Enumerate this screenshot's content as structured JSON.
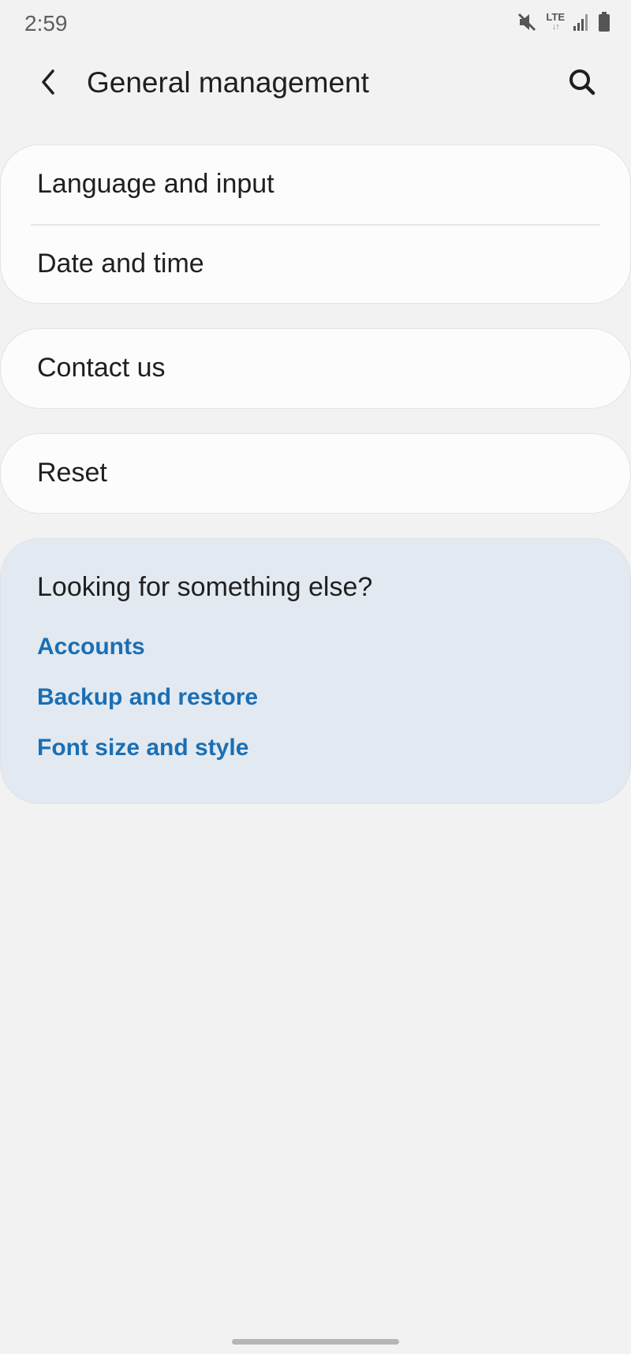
{
  "status_bar": {
    "time": "2:59",
    "network": "LTE",
    "network_arrows": "↓↑",
    "icons": [
      "mute-icon",
      "lte-icon",
      "signal-icon",
      "battery-icon"
    ]
  },
  "app_bar": {
    "title": "General management",
    "back_icon": "chevron-left-icon",
    "search_icon": "search-icon"
  },
  "groups": [
    {
      "items": [
        {
          "label": "Language and input"
        },
        {
          "label": "Date and time"
        }
      ]
    },
    {
      "items": [
        {
          "label": "Contact us"
        }
      ]
    },
    {
      "items": [
        {
          "label": "Reset"
        }
      ]
    }
  ],
  "suggestions": {
    "title": "Looking for something else?",
    "links": [
      {
        "label": "Accounts"
      },
      {
        "label": "Backup and restore"
      },
      {
        "label": "Font size and style"
      }
    ]
  },
  "colors": {
    "background": "#f2f2f2",
    "card": "#fcfcfc",
    "suggest_card": "#e3e9f0",
    "link": "#1a6fb5"
  }
}
